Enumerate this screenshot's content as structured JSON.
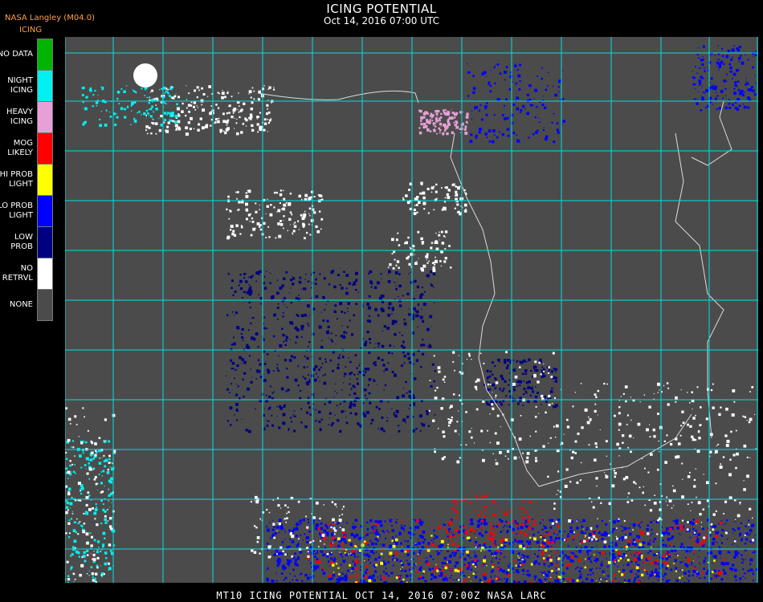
{
  "header": {
    "title": "ICING POTENTIAL",
    "subtitle": "Oct 14, 2016 07:00 UTC",
    "source": "NASA Langley (M04.0)"
  },
  "legend": {
    "title": "ICING",
    "items": [
      {
        "label": "NO DATA",
        "color": "#00b400"
      },
      {
        "label": "NIGHT\nICING",
        "color": "#00f0f0"
      },
      {
        "label": "HEAVY\nICING",
        "color": "#e6a0d6"
      },
      {
        "label": "MOG\nLIKELY",
        "color": "#ff0000"
      },
      {
        "label": "HI PROB\nLIGHT",
        "color": "#ffff00"
      },
      {
        "label": "LO PROB\nLIGHT",
        "color": "#0000ff"
      },
      {
        "label": "LOW\nPROB",
        "color": "#000080"
      },
      {
        "label": "NO\nRETRVL",
        "color": "#ffffff"
      },
      {
        "label": "NONE",
        "color": "#4b4b4b"
      }
    ]
  },
  "map": {
    "background": "#4b4b4b",
    "grid_color": "#00e0e0",
    "border_color": "#e0e0e0",
    "label_color": "#c02020"
  },
  "footer": {
    "text": "MT10  ICING POTENTIAL   OCT 14, 2016 07:00Z   NASA LARC"
  }
}
